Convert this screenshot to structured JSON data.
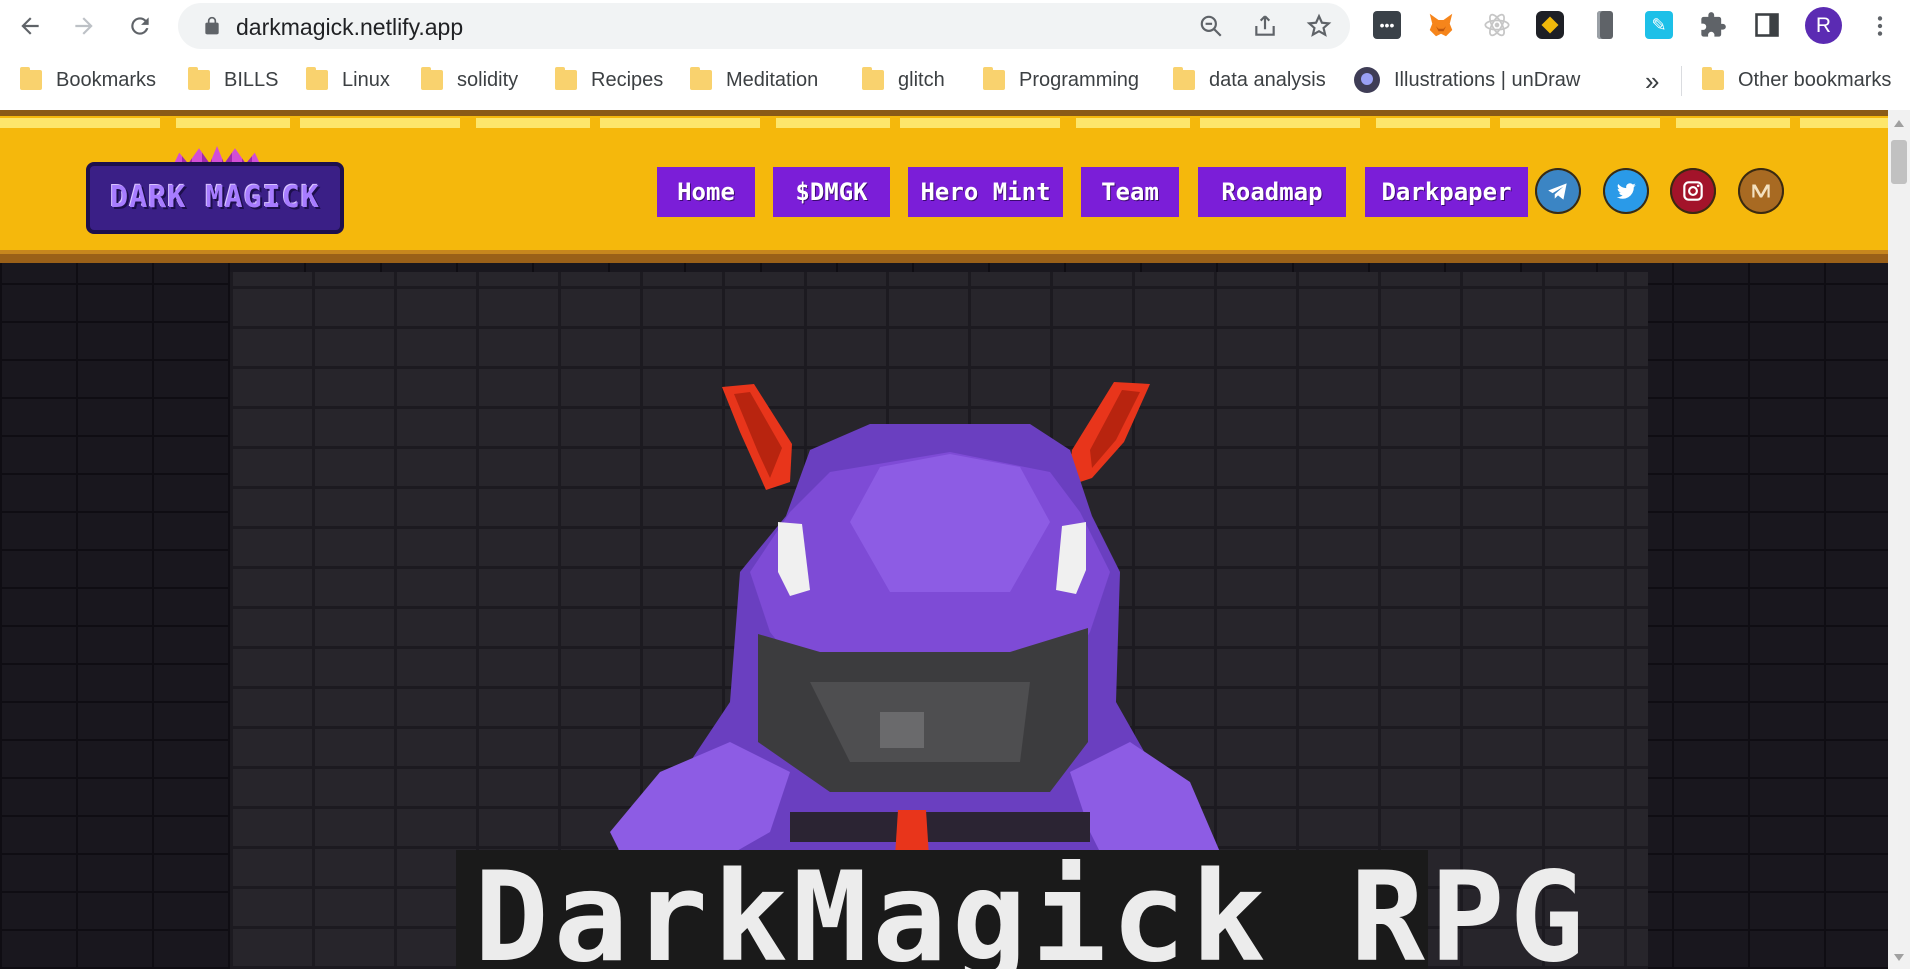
{
  "browser": {
    "url": "darkmagick.netlify.app",
    "profile_initial": "R",
    "extensions": [
      "password-manager-icon",
      "metamask-fox-icon",
      "react-devtools-icon",
      "binance-icon",
      "phone-icon",
      "feather-icon",
      "puzzle-icon",
      "sidebar-icon"
    ]
  },
  "bookmarks": {
    "items": [
      "Bookmarks",
      "BILLS",
      "Linux",
      "solidity",
      "Recipes",
      "Meditation",
      "glitch",
      "Programming",
      "data analysis"
    ],
    "undraw_label": "Illustrations | unDraw",
    "overflow": "»",
    "other": "Other bookmarks"
  },
  "site": {
    "logo_text": "DARK MAGICK",
    "menu": [
      "Home",
      "$DMGK",
      "Hero Mint",
      "Team",
      "Roadmap",
      "Darkpaper"
    ],
    "socials": [
      "telegram-icon",
      "twitter-icon",
      "instagram-icon",
      "medium-icon"
    ],
    "hero_title": "DarkMagick RPG"
  },
  "colors": {
    "header_yellow": "#f5b80c",
    "menu_purple": "#7b1ed8",
    "hero_purple": "#7e4bd6",
    "horn_red": "#e8351b"
  }
}
